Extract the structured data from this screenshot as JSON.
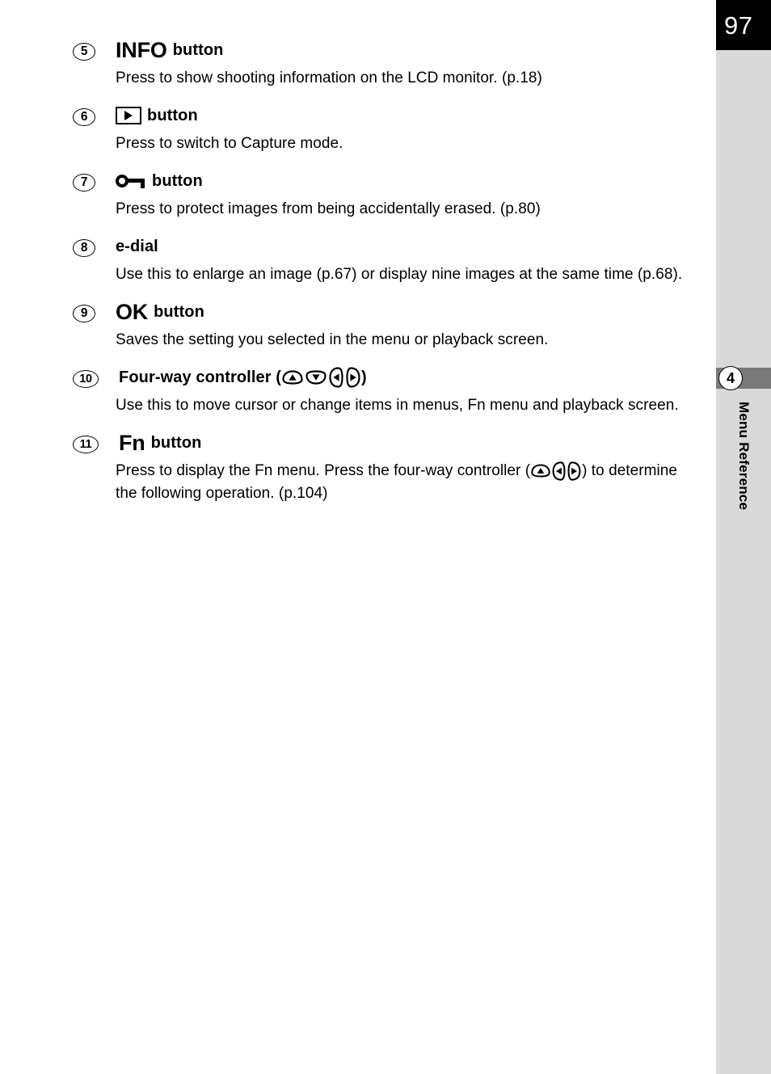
{
  "sidebar": {
    "page_number": "97",
    "chapter_number": "4",
    "chapter_label": "Menu Reference",
    "band_color": "#7a7a7a",
    "column_color": "#d9d9d9",
    "page_box_color": "#000000"
  },
  "entries": [
    {
      "number": "5",
      "heading_main": "INFO",
      "heading_suffix": "button",
      "icon": "none",
      "body": "Press to show shooting information on the LCD monitor. (p.18)"
    },
    {
      "number": "6",
      "heading_main": "",
      "heading_suffix": "button",
      "icon": "playback-icon",
      "body": "Press to switch to Capture mode."
    },
    {
      "number": "7",
      "heading_main": "",
      "heading_suffix": "button",
      "icon": "protect-key-icon",
      "body": "Press to protect images from being accidentally erased. (p.80)"
    },
    {
      "number": "8",
      "heading_main": "",
      "heading_suffix": "e-dial",
      "icon": "none",
      "body": "Use this to enlarge an image (p.67) or display nine images at the same time (p.68)."
    },
    {
      "number": "9",
      "heading_main": "OK",
      "heading_suffix": "button",
      "icon": "none",
      "body": "Saves the setting you selected in the menu or playback screen."
    },
    {
      "number": "10",
      "heading_main": "",
      "heading_suffix": "Four-way controller (",
      "heading_tail": ")",
      "icon": "four-way-arrows",
      "body": "Use this to move cursor or change items in menus, Fn menu and playback screen."
    },
    {
      "number": "11",
      "heading_main": "Fn",
      "heading_suffix": "button",
      "icon": "none",
      "body_part1": "Press to display the Fn menu. Press the four-way controller (",
      "body_part2": ") to determine the following operation. (p.104)"
    }
  ]
}
